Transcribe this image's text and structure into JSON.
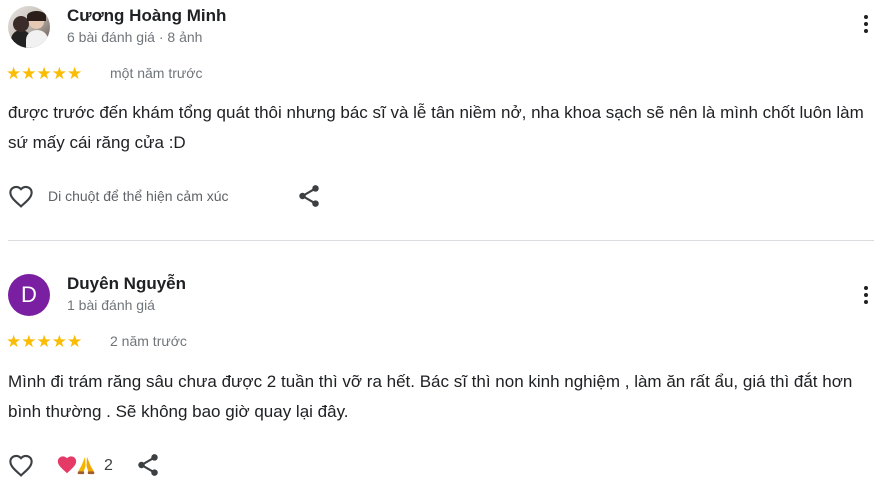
{
  "reviews": [
    {
      "author": "Cương Hoàng Minh",
      "meta": "6 bài đánh giá · 8 ảnh",
      "stars": "★★★★★",
      "rating": 5,
      "time": "một năm trước",
      "text": "được trước đến khám tổng quát thôi nhưng bác sĩ và lễ tân niềm nở, nha khoa sạch sẽ nên là mình chốt luôn làm sứ mấy cái răng cửa :D",
      "reaction_hint": "Di chuột để thể hiện cảm xúc"
    },
    {
      "author": "Duyên Nguyễn",
      "avatar_letter": "D",
      "avatar_color": "#7b1fa2",
      "meta": "1 bài đánh giá",
      "stars": "★★★★★",
      "rating": 5,
      "time": "2 năm trước",
      "text": "Mình đi trám răng sâu chưa được 2 tuần thì vỡ ra hết. Bác sĩ thì non kinh nghiệm , làm ăn rất ẩu, giá thì đắt hơn bình thường . Sẽ không bao giờ quay lại đây.",
      "reaction_count": "2",
      "reaction_emojis": [
        "heart",
        "folded-hands"
      ]
    }
  ],
  "colors": {
    "star": "#fbbc04",
    "text": "#202124",
    "secondary": "#70757a",
    "divider": "#dadce0",
    "heart_reaction": "#e53966",
    "hands_reaction": "#f4b400"
  },
  "icons": {
    "like": "heart-outline-icon",
    "share": "share-icon",
    "menu": "more-vert-icon"
  }
}
